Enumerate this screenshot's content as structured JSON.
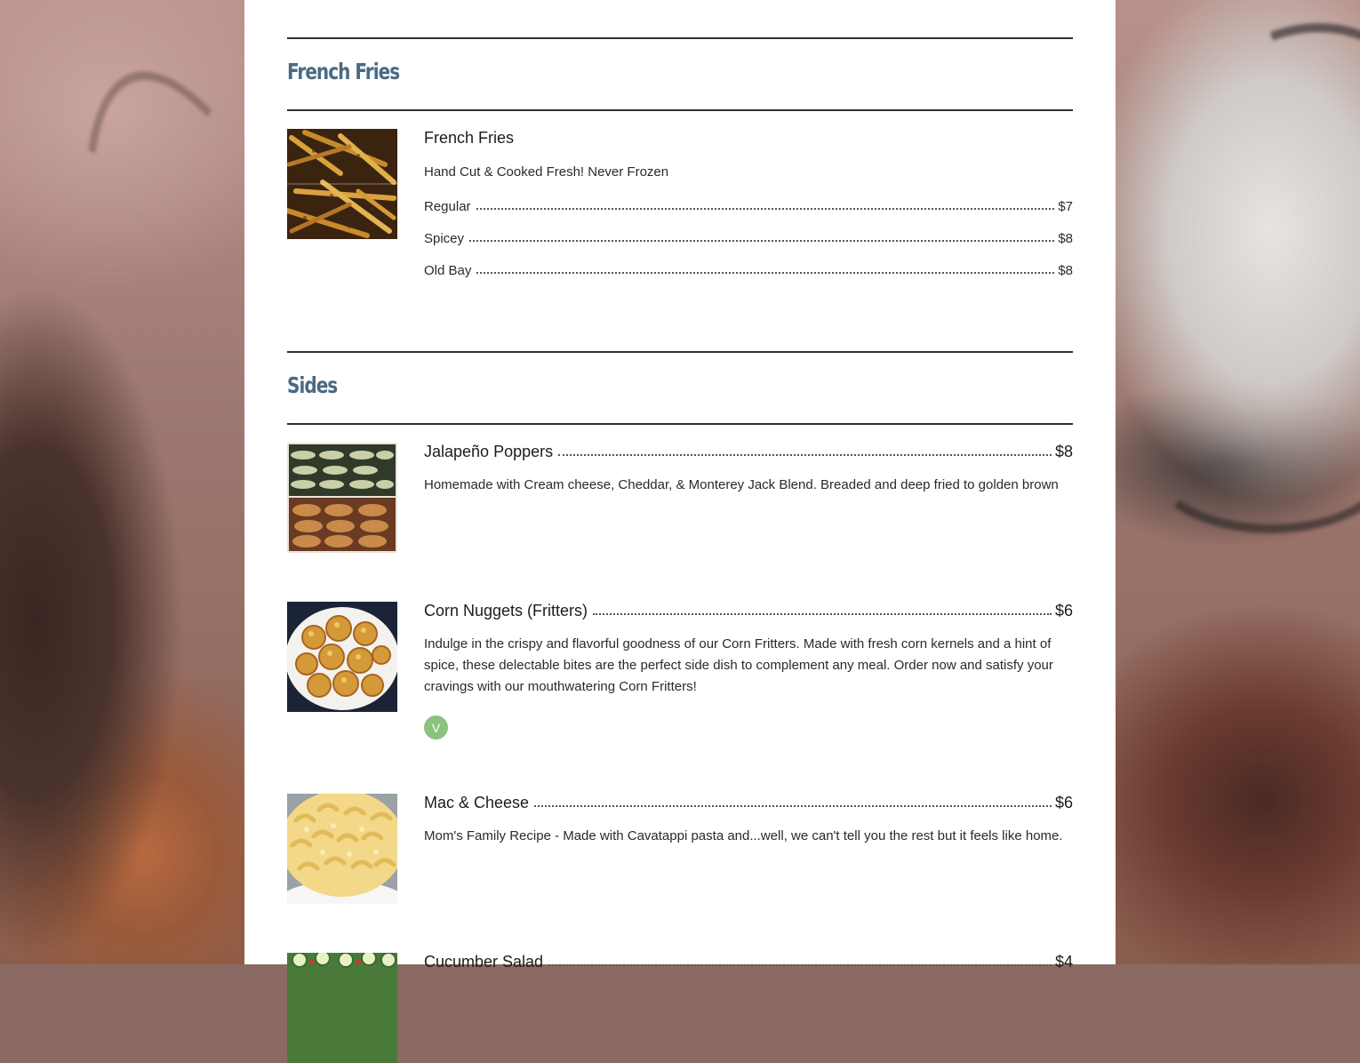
{
  "sections": [
    {
      "title": "French Fries",
      "items": [
        {
          "name": "French Fries",
          "description": "Hand Cut & Cooked Fresh! Never Frozen",
          "variants": [
            {
              "label": "Regular",
              "price": "$7"
            },
            {
              "label": "Spicey",
              "price": "$8"
            },
            {
              "label": "Old Bay",
              "price": "$8"
            }
          ]
        }
      ]
    },
    {
      "title": "Sides",
      "items": [
        {
          "name": "Jalapeño Poppers",
          "price": "$8",
          "description": "Homemade with Cream cheese, Cheddar, & Monterey Jack Blend. Breaded and deep fried to golden brown"
        },
        {
          "name": "Corn Nuggets (Fritters)",
          "price": "$6",
          "description": "Indulge in the crispy and flavorful goodness of our Corn Fritters. Made with fresh corn kernels and a hint of spice, these delectable bites are the perfect side dish to complement any meal. Order now and satisfy your cravings with our mouthwatering Corn Fritters!",
          "badge": "V"
        },
        {
          "name": "Mac & Cheese",
          "price": "$6",
          "description": "Mom's Family Recipe - Made with Cavatappi pasta and...well, we can't tell you the rest but it feels like home."
        },
        {
          "name": "Cucumber Salad",
          "price": "$4"
        }
      ]
    }
  ],
  "colors": {
    "section_title": "#4a6a82",
    "rule": "#2f2f2f",
    "badge": "#8ac27e"
  }
}
